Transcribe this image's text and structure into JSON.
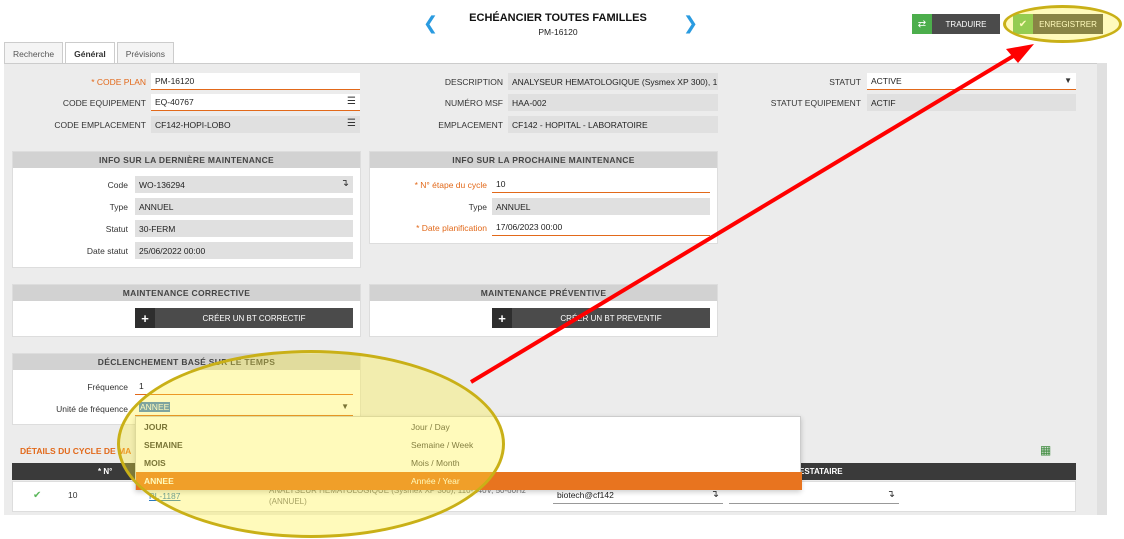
{
  "header": {
    "title": "ECHÉANCIER TOUTES FAMILLES",
    "subtitle": "PM-16120"
  },
  "toolbar": {
    "translate_label": "TRADUIRE",
    "save_label": "ENREGISTRER"
  },
  "tabs": [
    {
      "label": "Recherche"
    },
    {
      "label": "Général"
    },
    {
      "label": "Prévisions"
    }
  ],
  "general": {
    "code_plan_label": "* CODE PLAN",
    "code_plan": "PM-16120",
    "code_equipement_label": "CODE EQUIPEMENT",
    "code_equipement": "EQ-40767",
    "code_emplacement_label": "CODE EMPLACEMENT",
    "code_emplacement": "CF142-HOPI-LOBO",
    "description_label": "DESCRIPTION",
    "description": "ANALYSEUR HEMATOLOGIQUE (Sysmex XP 300), 1",
    "numero_msf_label": "NUMÉRO MSF",
    "numero_msf": "HAA-002",
    "emplacement_label": "EMPLACEMENT",
    "emplacement": "CF142 - HOPITAL - LABORATOIRE",
    "statut_label": "STATUT",
    "statut": "ACTIVE",
    "statut_equipement_label": "STATUT EQUIPEMENT",
    "statut_equipement": "ACTIF"
  },
  "last_maint": {
    "title": "INFO SUR LA DERNIÈRE MAINTENANCE",
    "code_label": "Code",
    "code": "WO-136294",
    "type_label": "Type",
    "type": "ANNUEL",
    "statut_label": "Statut",
    "statut": "30-FERM",
    "date_label": "Date statut",
    "date": "25/06/2022 00:00"
  },
  "next_maint": {
    "title": "INFO SUR LA PROCHAINE MAINTENANCE",
    "etape_label": "* N° étape du cycle",
    "etape": "10",
    "type_label": "Type",
    "type": "ANNUEL",
    "date_label": "* Date planification",
    "date": "17/06/2023 00:00"
  },
  "corrective": {
    "title": "MAINTENANCE CORRECTIVE",
    "button": "CRÉER UN BT CORRECTIF"
  },
  "preventive": {
    "title": "MAINTENANCE PRÉVENTIVE",
    "button": "CRÉER UN BT PREVENTIF"
  },
  "trigger": {
    "title": "DÉCLENCHEMENT BASÉ SUR LE TEMPS",
    "frequence_label": "Fréquence",
    "frequence": "1",
    "unite_label": "Unité de fréquence",
    "unite": "ANNEE"
  },
  "dropdown": {
    "options": [
      {
        "code": "JOUR",
        "label": "Jour / Day"
      },
      {
        "code": "SEMAINE",
        "label": "Semaine / Week"
      },
      {
        "code": "MOIS",
        "label": "Mois / Month"
      },
      {
        "code": "ANNEE",
        "label": "Année / Year"
      }
    ]
  },
  "cycle": {
    "title": "DÉTAILS DU CYCLE DE MA",
    "col_no": "* N°",
    "col_prestataire": "ESTATAIRE",
    "row": {
      "no": "10",
      "plan": "PL-1187",
      "desc_line1": "ANALYSEUR HEMATOLOGIQUE (Sysmex XP 300), 110-240V, 50-60Hz",
      "desc_line2": "(ANNUEL)",
      "contact": "biotech@cf142"
    }
  },
  "colors": {
    "accent": "#e2691a",
    "save_green": "#5cb85c",
    "highlight": "#f2ef6a",
    "arrow": "#ff0000"
  }
}
